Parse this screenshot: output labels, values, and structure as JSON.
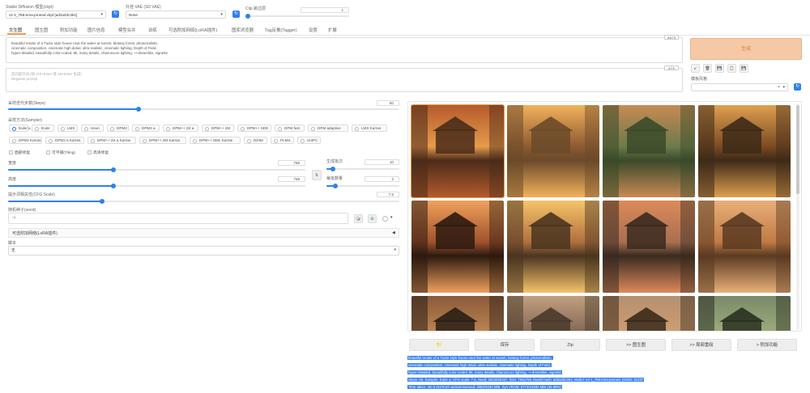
{
  "top": {
    "checkpoint_label": "Stable Diffusion 模型(ckpt)",
    "checkpoint_value": "v2-1_768-ema-pruned.ckpt [ad2a33c361]",
    "vae_label": "外挂 VAE (SD VAE)",
    "vae_value": "None",
    "clip_label": "Clip 跳过层",
    "clip_value": "1",
    "clip_fraction": 0.0
  },
  "tabs": [
    "文生图",
    "图生图",
    "附加功能",
    "图片信息",
    "模型合并",
    "训练",
    "可选附加网络(LoRA插件)",
    "图库浏览器",
    "Tag反推(Tagger)",
    "设置",
    "扩展"
  ],
  "active_tab": 0,
  "prompt": {
    "text_lines": [
      "beautiful render of a Tudor style house near the water at sunset, fantasy forest. photorealistic,",
      "cinematic composition, cinematic high detail, ultra realistic, cinematic lighting, Depth of Field,",
      "hyper-detailed, beautifully color-coded, 8k, many details, chiaroscuro lighting, ++dreamlike, vignette"
    ],
    "counter": "63/75",
    "neg_label": "反向提示词 (按 Ctrl+Enter 或 Alt+Enter 生成)",
    "neg_placeholder": "Negative prompt",
    "neg_counter": "0/75"
  },
  "right": {
    "generate_label": "生成",
    "tool_icons": [
      "↙",
      "🗑",
      "💾",
      "📋",
      "💾"
    ],
    "style_label": "模板风格",
    "style_clear": "×",
    "style_caret": "▾"
  },
  "params": {
    "steps_label": "采样迭代步数(Steps)",
    "steps_value": "50",
    "steps_fraction": 0.333,
    "sampler_label": "采样方法(Sampler)",
    "samplers_row1": [
      "Euler a",
      "Euler",
      "LMS",
      "Heun",
      "DPM2",
      "DPM2 a",
      "DPM++ 2S a",
      "DPM++ 2M",
      "DPM++ SDE",
      "DPM fast",
      "DPM adaptive",
      "LMS Karras"
    ],
    "samplers_row2": [
      "DPM2 Karras",
      "DPM2 a Karras",
      "DPM++ 2S a Karras",
      "DPM++ 2M Karras",
      "DPM++ SDE Karras",
      "DDIM",
      "PLMS",
      "UniPC"
    ],
    "selected_sampler": "Euler a",
    "checks": [
      "面部修复",
      "可平铺(Tiling)",
      "高清修复"
    ],
    "width_label": "宽度",
    "width_value": "768",
    "width_fraction": 0.353,
    "height_label": "高度",
    "height_value": "768",
    "height_fraction": 0.353,
    "swap_icon": "⇅",
    "batch_count_label": "生成批次",
    "batch_count_value": "10",
    "batch_count_fraction": 0.09,
    "batch_size_label": "每批数量",
    "batch_size_value": "2",
    "batch_size_fraction": 0.125,
    "cfg_label": "提示词相关性(CFG Scale)",
    "cfg_value": "7.5",
    "cfg_fraction": 0.241,
    "seed_label": "随机种子(seed)",
    "seed_value": "-1",
    "seed_icons": [
      "🎲",
      "♻"
    ],
    "extra_label": "▾",
    "lora_label": "可选附加网络(LoRA插件)",
    "lora_caret": "◀",
    "script_label": "脚本",
    "script_value": "无",
    "script_caret": "▾"
  },
  "actions": [
    "📁",
    "保存",
    "Zip",
    ">> 图生图",
    ">> 局部重绘",
    "> 附加功能"
  ],
  "info_lines": [
    "beautiful render of a Tudor style house near the water at sunset, fantasy forest. photorealistic,",
    "cinematic composition, cinematic high detail, ultra realistic, cinematic lighting, Depth of Field,",
    "hyper-detailed, beautifully color-coded, 8k, many details, chiaroscuro lighting, ++dreamlike, vignette",
    "Steps: 50, Sampler: Euler a, CFG scale: 7.5, Seed: 3634040167, Size: 768x768, Model hash: ad2a33c361, Model: v2-1_768-ema-pruned, ENSD: 31337",
    "Time taken: 4m 5.31sTorch active/reserved: 3382/4040 MiB, Sys VRAM: 5772/12282 MiB (46.99%)"
  ],
  "colors": {
    "accent": "#2f80ed",
    "generate_bg": "#f5c9a6",
    "generate_text": "#e07a3b",
    "info_bg": "#3b82f6"
  }
}
